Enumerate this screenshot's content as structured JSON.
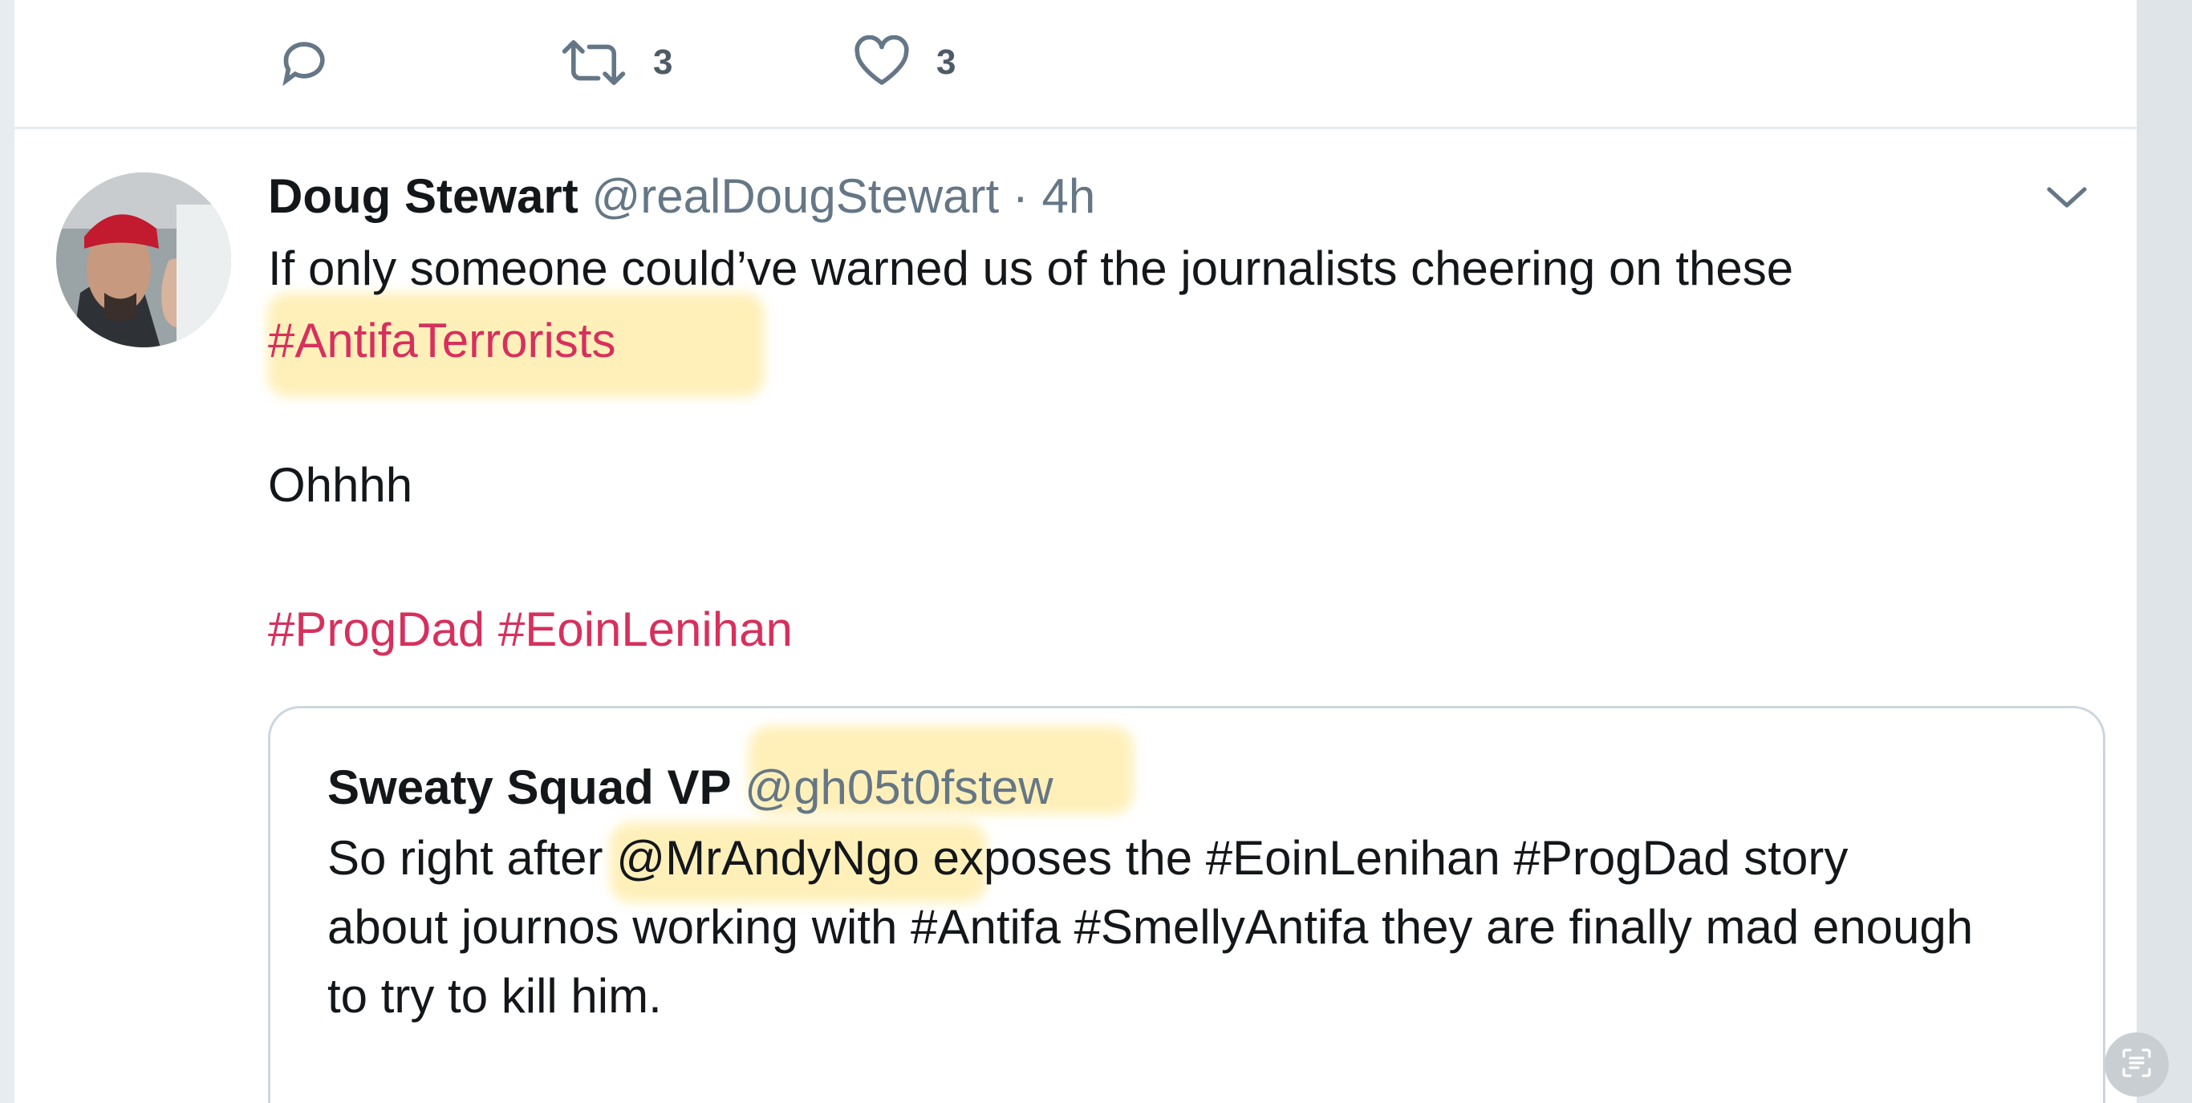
{
  "prev_tweet_actions": {
    "reply_icon": "speech-bubble-icon",
    "retweet_icon": "retweet-icon",
    "retweet_count": "3",
    "like_icon": "heart-icon",
    "like_count": "3"
  },
  "tweet": {
    "name": "Doug Stewart",
    "handle": "@realDougStewart",
    "separator": "·",
    "time": "4h",
    "menu_icon": "chevron-down-icon",
    "line1": "If only someone could’ve warned us of the journalists cheering on these",
    "hashtag_line": "#AntifaTerrorists",
    "line3": "Ohhhh",
    "hashtags": [
      "#ProgDad",
      "#EoinLenihan"
    ]
  },
  "quoted_tweet": {
    "name": "Sweaty Squad VP",
    "handle": "@gh05t0fstew",
    "line1_prefix": "So right after",
    "line1_mention": "@MrAndyNgo",
    "line1_suffix": "exposes the #EoinLenihan #ProgDad story",
    "line2": "about journos working with #Antifa #SmellyAntifa they are finally mad enough",
    "line3": "to try to kill him."
  },
  "colors": {
    "hashtag": "#d7305d",
    "secondary_text": "#657786",
    "primary_text": "#14171a",
    "highlight": "#ffdb5a"
  },
  "floating_button_icon": "text-recognition-icon"
}
